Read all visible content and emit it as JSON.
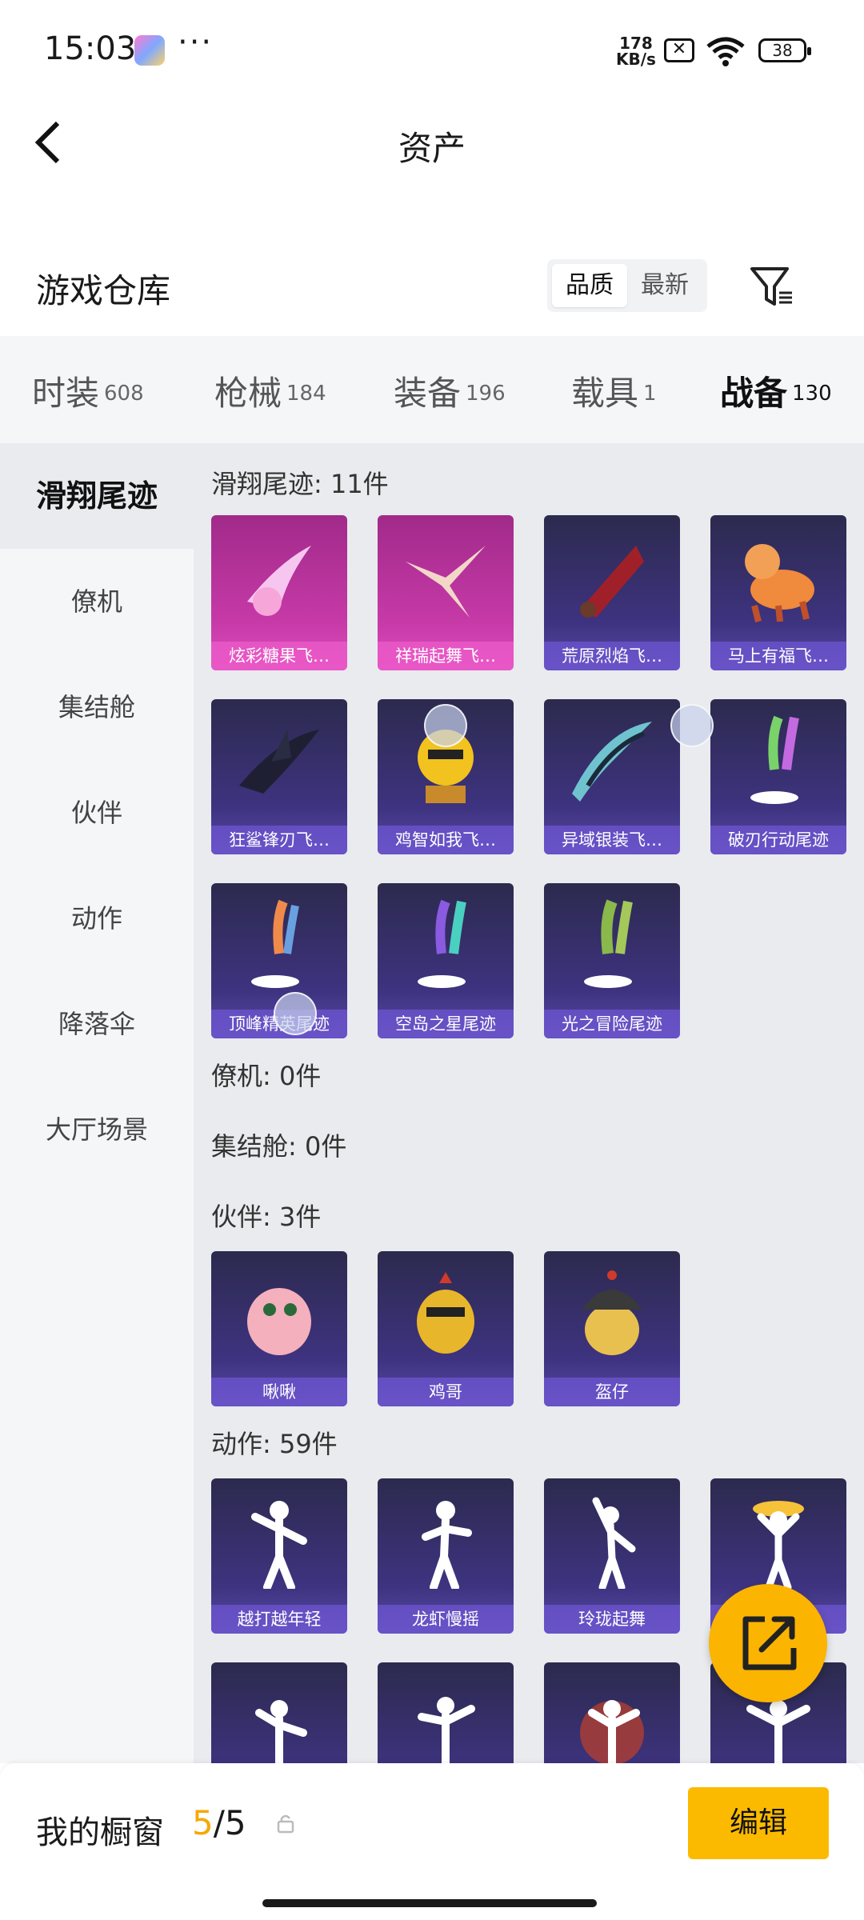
{
  "status": {
    "time": "15:03",
    "more": "···",
    "speed_top": "178",
    "speed_unit": "KB/s",
    "battery": "38"
  },
  "nav": {
    "title": "资产"
  },
  "header": {
    "title": "游戏仓库",
    "sort_options": [
      "品质",
      "最新"
    ]
  },
  "tabs": [
    {
      "label": "时装",
      "count": "608"
    },
    {
      "label": "枪械",
      "count": "184"
    },
    {
      "label": "装备",
      "count": "196"
    },
    {
      "label": "载具",
      "count": "1"
    },
    {
      "label": "战备",
      "count": "130"
    }
  ],
  "sidebar": [
    "滑翔尾迹",
    "僚机",
    "集结舱",
    "伙伴",
    "动作",
    "降落伞",
    "大厅场景"
  ],
  "sections": {
    "glide": {
      "title": "滑翔尾迹: 11件",
      "items": [
        "炫彩糖果飞…",
        "祥瑞起舞飞…",
        "荒原烈焰飞…",
        "马上有福飞…",
        "狂鲨锋刃飞…",
        "鸡智如我飞…",
        "异域银装飞…",
        "破刃行动尾迹",
        "顶峰精英尾迹",
        "空岛之星尾迹",
        "光之冒险尾迹"
      ]
    },
    "wingman": {
      "title": "僚机: 0件"
    },
    "pod": {
      "title": "集结舱: 0件"
    },
    "partner": {
      "title": "伙伴: 3件",
      "items": [
        "啾啾",
        "鸡哥",
        "盔仔"
      ]
    },
    "emote": {
      "title": "动作: 59件",
      "items": [
        "越打越年轻",
        "龙虾慢摇",
        "玲珑起舞"
      ]
    }
  },
  "bottom": {
    "label": "我的橱窗",
    "current": "5",
    "total": "/5",
    "edit": "编辑"
  }
}
